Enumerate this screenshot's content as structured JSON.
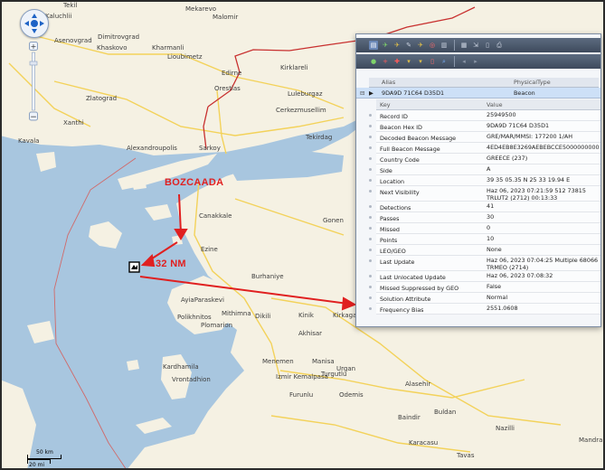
{
  "map": {
    "places": [
      "Tekil",
      "Kaluchlii",
      "Mekarevo",
      "Malomir",
      "Asenovgrad",
      "Dimitrovgrad",
      "Khaskovo",
      "Kharmanli",
      "Lioubimetz",
      "Edirne",
      "Orestias",
      "Kirklareli",
      "Zlatograd",
      "Luleburgaz",
      "Xanthi",
      "Cerkezmusellim",
      "Alexandroupolis",
      "Tekirdag",
      "Kavala",
      "Sarkoy",
      "Canakkale",
      "Gonen",
      "Ezine",
      "Burhaniye",
      "AyiaParaskevi",
      "Mithimna",
      "Polikhnitos",
      "Dikili",
      "Plomarion",
      "Kinik",
      "Kirkagac",
      "Akhisar",
      "Menemen",
      "Manisa",
      "Kardhamila",
      "Turgutlu",
      "Vrontadhion",
      "Izmir Kemalpasa",
      "Urgan",
      "Furunlu",
      "Odemis",
      "Alasehir",
      "Buldan",
      "Nazilli",
      "Karacasu",
      "Tavas",
      "Mandra",
      "Baindir"
    ],
    "annotations": {
      "island": "BOZCAADA",
      "distance": "32 NM"
    },
    "scale": {
      "km": "50 km",
      "mi": "20 mi"
    },
    "colors": {
      "land": "#f5f1e3",
      "sea": "#a8c6df",
      "road": "#f3d25a",
      "border": "#c8302f",
      "arrow": "#e02020"
    }
  },
  "panel": {
    "toolbar_icons": [
      "table-icon",
      "plane-icon",
      "plane-icon",
      "edit-icon",
      "plane-icon",
      "target-icon",
      "dataset-icon",
      "grid-icon",
      "export-icon",
      "printer-icon",
      "beacon-icon",
      "add-icon",
      "delete-icon",
      "filter-icon",
      "filter-icon",
      "column-icon",
      "search-icon",
      "close-icon",
      "arrow-icon"
    ],
    "columns": {
      "alias": "Alias",
      "physical_type": "PhysicalType"
    },
    "beacon": {
      "alias": "9DA9D 71C64 D35D1",
      "type": "Beacon"
    },
    "detail_columns": {
      "key": "Key",
      "value": "Value"
    },
    "rows": [
      {
        "key": "Record ID",
        "value": "25949500"
      },
      {
        "key": "Beacon Hex ID",
        "value": "9DA9D 71C64 D35D1"
      },
      {
        "key": "Decoded Beacon Message",
        "value": "GRE/MAR/MMSI: 177200 1/AH"
      },
      {
        "key": "Full Beacon Message",
        "value": "4ED4EB8E3269AEBEBCCE5000000000"
      },
      {
        "key": "Country Code",
        "value": "GREECE (237)"
      },
      {
        "key": "Side",
        "value": "A"
      },
      {
        "key": "Location",
        "value": "39 35 05.35 N  25 33 19.94 E"
      },
      {
        "key": "Next Visibility",
        "value": "Haz 06, 2023 07:21:59 512 73815 TRLUT2 (2712) 00:13:33"
      },
      {
        "key": "Detections",
        "value": "41"
      },
      {
        "key": "Passes",
        "value": "30"
      },
      {
        "key": "Missed",
        "value": "0"
      },
      {
        "key": "Points",
        "value": "10"
      },
      {
        "key": "LEO/GEO",
        "value": "None"
      },
      {
        "key": "Last Update",
        "value": "Haz 06, 2023 07:04:25 Multiple 68066 TRMEO (2714)"
      },
      {
        "key": "Last Unlocated Update",
        "value": "Haz 06, 2023 07:08:32"
      },
      {
        "key": "Missed Suppressed by GEO Detections",
        "value": "False"
      },
      {
        "key": "Solution Attribute",
        "value": "Normal"
      },
      {
        "key": "Frequency Bias",
        "value": "2551.0608"
      }
    ]
  }
}
